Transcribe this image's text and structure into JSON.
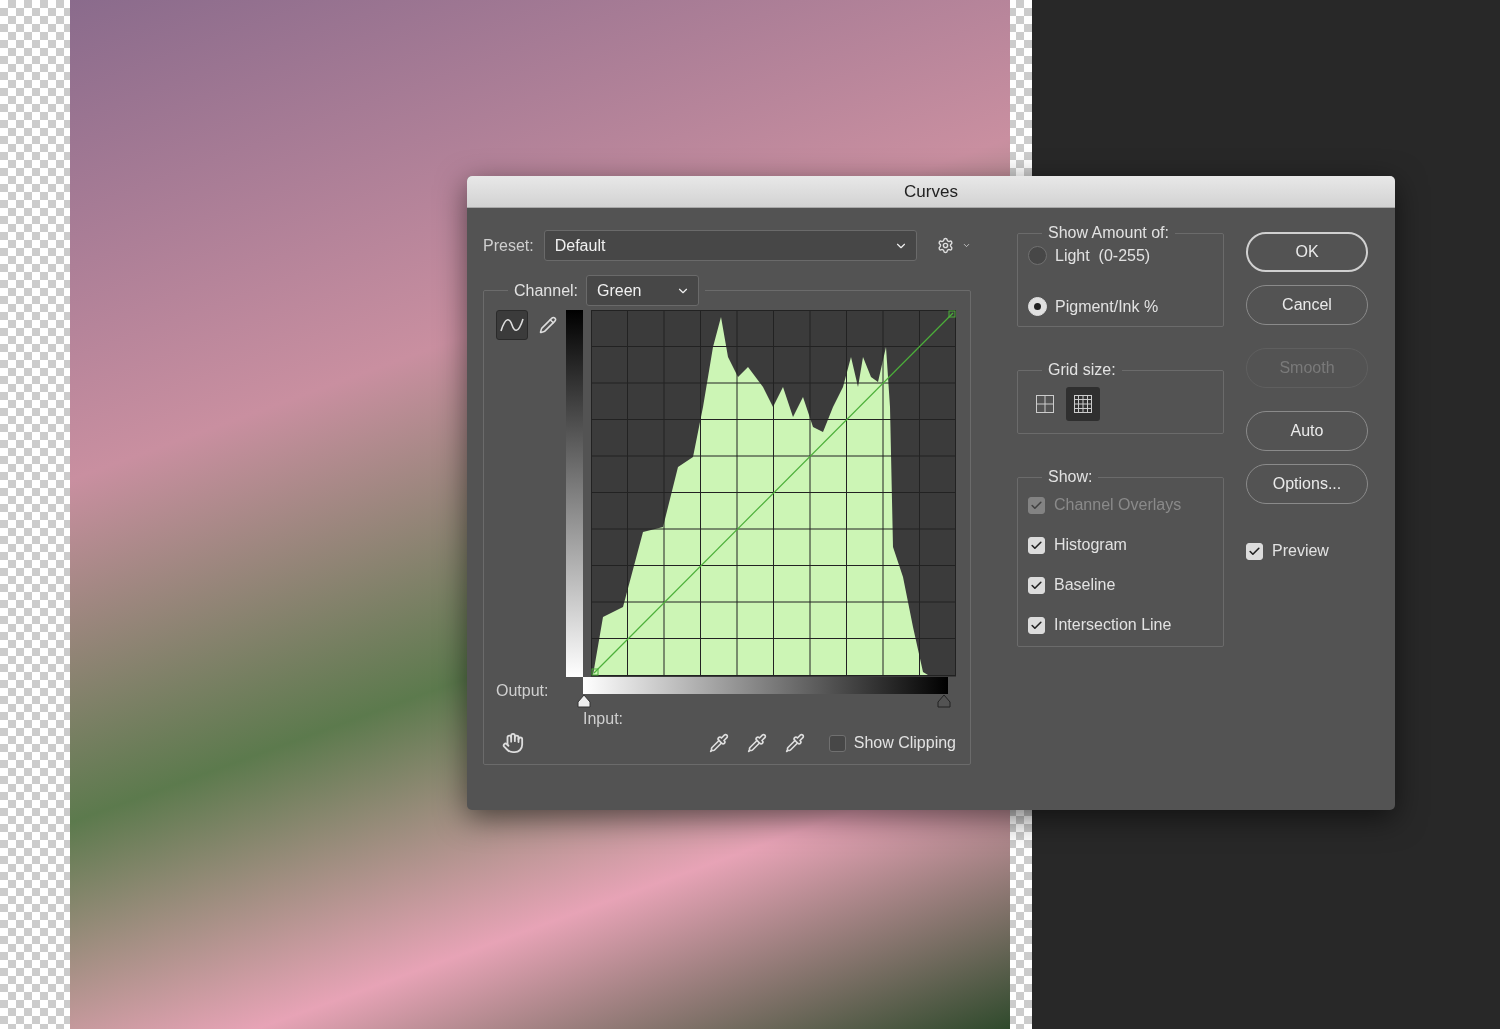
{
  "dialog": {
    "title": "Curves",
    "preset": {
      "label": "Preset:",
      "value": "Default"
    },
    "channel": {
      "label": "Channel:",
      "value": "Green"
    },
    "curve_tools": [
      {
        "kind": "curve",
        "selected": true
      },
      {
        "kind": "pencil",
        "selected": false
      }
    ],
    "output_label": "Output:",
    "input_label": "Input:",
    "show_clipping": {
      "label": "Show Clipping",
      "checked": false
    },
    "show_amount": {
      "title": "Show Amount of:",
      "options": [
        {
          "label": "Light  (0-255)",
          "selected": false
        },
        {
          "label": "Pigment/Ink %",
          "selected": true
        }
      ]
    },
    "grid_size": {
      "title": "Grid size:",
      "options": [
        {
          "kind": "coarse",
          "selected": false
        },
        {
          "kind": "fine",
          "selected": true
        }
      ]
    },
    "show": {
      "title": "Show:",
      "options": [
        {
          "label": "Channel Overlays",
          "checked": true,
          "disabled": true
        },
        {
          "label": "Histogram",
          "checked": true,
          "disabled": false
        },
        {
          "label": "Baseline",
          "checked": true,
          "disabled": false
        },
        {
          "label": "Intersection Line",
          "checked": true,
          "disabled": false
        }
      ]
    },
    "buttons": [
      {
        "label": "OK",
        "default": true,
        "disabled": false
      },
      {
        "label": "Cancel",
        "default": false,
        "disabled": false
      },
      {
        "label": "Smooth",
        "default": false,
        "disabled": true
      },
      {
        "label": "Auto",
        "default": false,
        "disabled": false
      },
      {
        "label": "Options...",
        "default": false,
        "disabled": false
      }
    ],
    "preview": {
      "label": "Preview",
      "checked": true
    }
  }
}
